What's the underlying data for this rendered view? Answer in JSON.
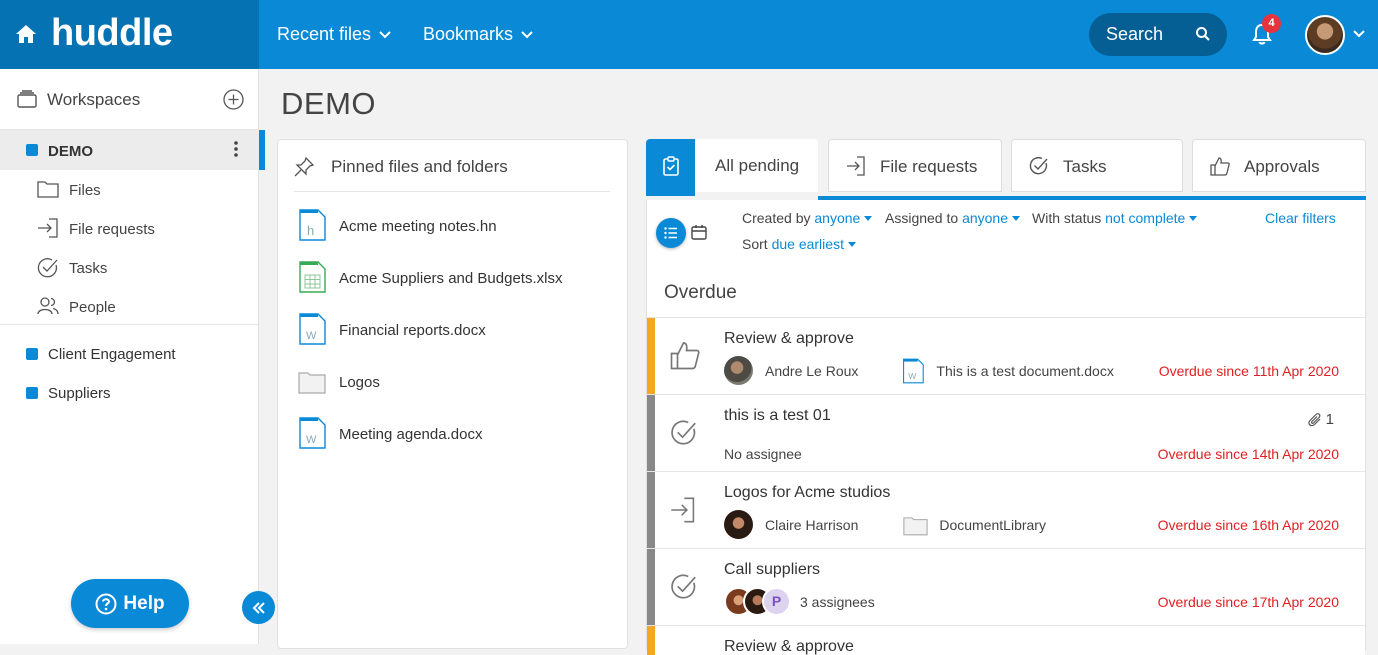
{
  "brand": {
    "logo_text": "huddle"
  },
  "topnav": {
    "recent_files": "Recent files",
    "bookmarks": "Bookmarks",
    "search": "Search",
    "notification_count": "4"
  },
  "sidebar": {
    "workspaces_label": "Workspaces",
    "current_workspace": "DEMO",
    "sub_items": [
      {
        "label": "Files",
        "icon": "folder-icon"
      },
      {
        "label": "File requests",
        "icon": "file-request-icon"
      },
      {
        "label": "Tasks",
        "icon": "check-circle-icon"
      },
      {
        "label": "People",
        "icon": "people-icon"
      }
    ],
    "other_workspaces": [
      "Client Engagement",
      "Suppliers"
    ],
    "help_label": "Help"
  },
  "main": {
    "page_title": "DEMO",
    "pinned": {
      "title": "Pinned files and folders",
      "items": [
        {
          "label": "Acme meeting notes.hn",
          "icon": "huddle-note-icon"
        },
        {
          "label": "Acme Suppliers and Budgets.xlsx",
          "icon": "spreadsheet-icon"
        },
        {
          "label": "Financial reports.docx",
          "icon": "word-doc-icon"
        },
        {
          "label": "Logos",
          "icon": "folder-icon"
        },
        {
          "label": "Meeting agenda.docx",
          "icon": "word-doc-icon"
        }
      ]
    },
    "tasks_panel": {
      "tabs": [
        "All pending",
        "File requests",
        "Tasks",
        "Approvals"
      ],
      "filters": {
        "created_by_label": "Created by",
        "created_by_value": "anyone",
        "assigned_to_label": "Assigned to",
        "assigned_to_value": "anyone",
        "status_label": "With status",
        "status_value": "not complete",
        "sort_label": "Sort",
        "sort_value": "due earliest",
        "clear": "Clear filters"
      },
      "section_heading": "Overdue",
      "tasks": [
        {
          "title": "Review & approve",
          "type": "approval",
          "assignee": "Andre Le Roux",
          "file": "This is a test document.docx",
          "due": "Overdue since 11th Apr 2020",
          "stripe": "#f5a623"
        },
        {
          "title": "this is a test 01",
          "type": "task",
          "assignee": "No assignee",
          "attachments": "1",
          "due": "Overdue since 14th Apr 2020",
          "stripe": "#888888"
        },
        {
          "title": "Logos for Acme studios",
          "type": "file-request",
          "assignee": "Claire Harrison",
          "file": "DocumentLibrary",
          "due": "Overdue since 16th Apr 2020",
          "stripe": "#888888"
        },
        {
          "title": "Call suppliers",
          "type": "task",
          "assignee": "3 assignees",
          "avatar_initial": "P",
          "due": "Overdue since 17th Apr 2020",
          "stripe": "#888888"
        },
        {
          "title": "Review & approve",
          "type": "approval",
          "stripe": "#f5a623"
        }
      ]
    }
  },
  "colors": {
    "primary": "#0a8ad6",
    "brand_dark": "#0572b3",
    "overdue": "#e02020",
    "approval_stripe": "#f5a623"
  }
}
